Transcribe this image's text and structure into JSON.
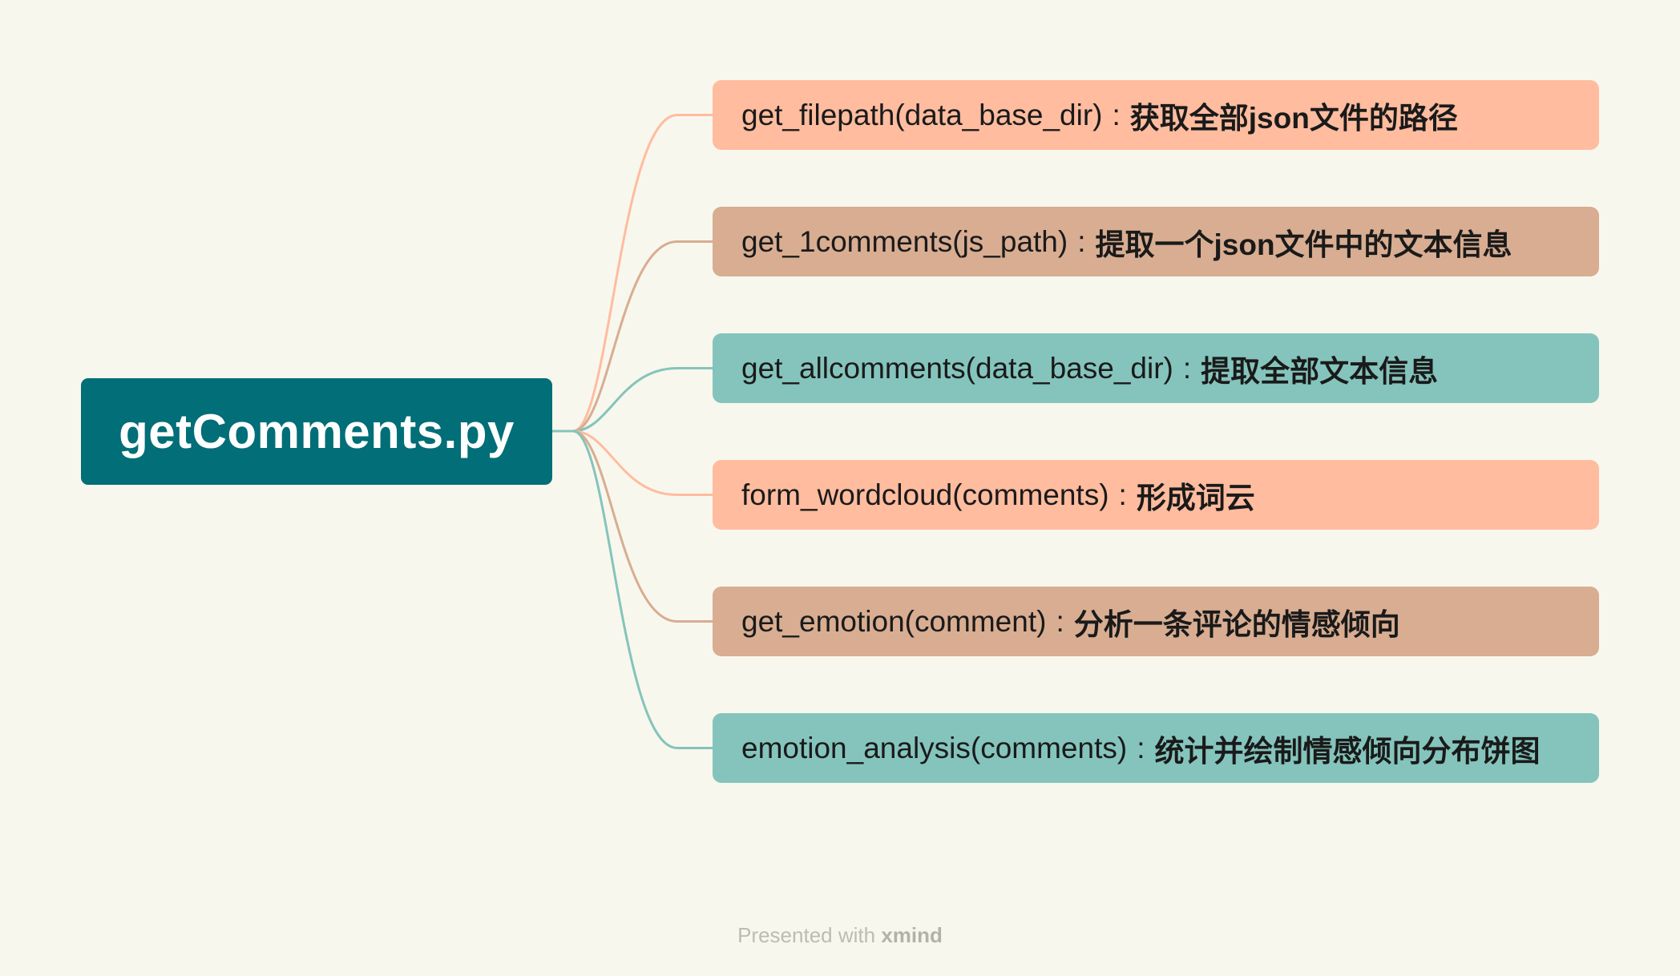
{
  "root": {
    "label": "getComments.py",
    "color": "#026e77"
  },
  "branches": [
    {
      "function": "get_filepath(data_base_dir)",
      "separator": ":",
      "description": "获取全部json文件的路径",
      "color": "#ffbc9f",
      "line_color": "#ffbc9f"
    },
    {
      "function": "get_1comments(js_path)",
      "separator": ":",
      "description": "提取一个json文件中的文本信息",
      "color": "#d8ad91",
      "line_color": "#d8ad91"
    },
    {
      "function": "get_allcomments(data_base_dir)",
      "separator": ":",
      "description": "提取全部文本信息",
      "color": "#84c4bc",
      "line_color": "#84c4bc"
    },
    {
      "function": "form_wordcloud(comments)",
      "separator": ":",
      "description": "形成词云",
      "color": "#ffbc9f",
      "line_color": "#ffbc9f"
    },
    {
      "function": "get_emotion(comment)",
      "separator": ":",
      "description": "分析一条评论的情感倾向",
      "color": "#d8ad91",
      "line_color": "#d8ad91"
    },
    {
      "function": "emotion_analysis(comments)",
      "separator": ":",
      "description": "统计并绘制情感倾向分布饼图",
      "color": "#84c4bc",
      "line_color": "#84c4bc"
    }
  ],
  "footer": {
    "prefix": "Presented with",
    "brand": "xmind"
  }
}
